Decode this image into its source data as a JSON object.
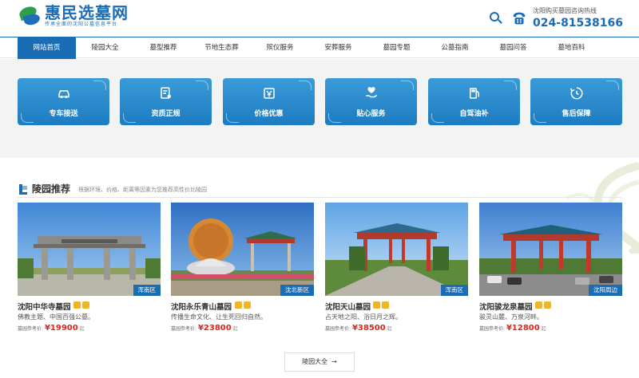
{
  "brand": {
    "title": "惠民选墓网",
    "subtitle": "传承全面的沈阳公墓信息平台"
  },
  "hotline": {
    "label": "沈阳购买墓园咨询热线",
    "number": "024-81538166"
  },
  "nav": {
    "items": [
      "网站首页",
      "陵园大全",
      "墓型推荐",
      "节地生态葬",
      "殡仪服务",
      "安葬服务",
      "墓园专题",
      "公墓指南",
      "墓园问答",
      "墓地百科"
    ]
  },
  "services": [
    {
      "label": "专车接送",
      "icon": "car-icon"
    },
    {
      "label": "资质正规",
      "icon": "certificate-icon"
    },
    {
      "label": "价格优惠",
      "icon": "price-tag-icon"
    },
    {
      "label": "贴心服务",
      "icon": "heart-hand-icon"
    },
    {
      "label": "自驾油补",
      "icon": "fuel-pump-icon"
    },
    {
      "label": "售后保障",
      "icon": "refresh-shield-icon"
    }
  ],
  "section": {
    "title": "陵园推荐",
    "desc": "根据环境、价格、距离等因素为您推荐高性价比陵园"
  },
  "cemeteries": [
    {
      "name": "沈阳中华寺墓园",
      "region": "浑南区",
      "desc": "佛教主题、中国百强公墓。",
      "price_label": "墓园参考价:",
      "price": "¥19900",
      "unit": "起"
    },
    {
      "name": "沈阳永乐青山墓园",
      "region": "沈北新区",
      "desc": "传播生命文化、让生死回归自然。",
      "price_label": "墓园参考价:",
      "price": "¥23800",
      "unit": "起"
    },
    {
      "name": "沈阳天山墓园",
      "region": "浑南区",
      "desc": "占天地之阳、浴日月之辉。",
      "price_label": "墓园参考价:",
      "price": "¥38500",
      "unit": "起"
    },
    {
      "name": "沈阳骏龙泉墓园",
      "region": "沈阳周边",
      "desc": "骏灵山麓、万泉河畔。",
      "price_label": "墓园参考价:",
      "price": "¥12800",
      "unit": "起"
    }
  ],
  "more": {
    "label": "陵园大全"
  },
  "colors": {
    "primary": "#1a6cb5",
    "price": "#e0251b",
    "badge_gold": "#f0b428"
  }
}
